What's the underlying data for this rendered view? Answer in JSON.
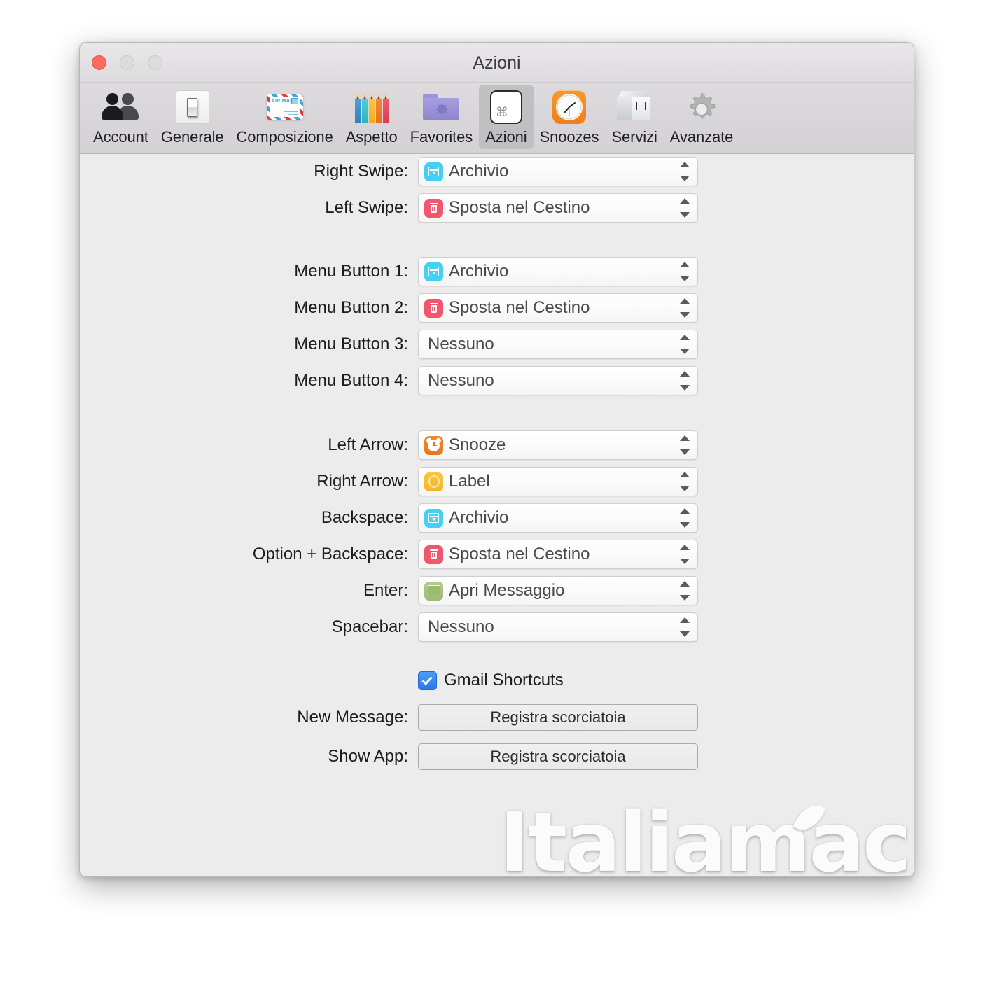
{
  "window": {
    "title": "Azioni",
    "traffic_lights": [
      "close",
      "minimize",
      "zoom"
    ]
  },
  "toolbar": {
    "items": [
      {
        "label": "Account",
        "icon": "people-icon",
        "selected": false
      },
      {
        "label": "Generale",
        "icon": "switch-icon",
        "selected": false
      },
      {
        "label": "Composizione",
        "icon": "airmail-icon",
        "selected": false
      },
      {
        "label": "Aspetto",
        "icon": "pencils-icon",
        "selected": false
      },
      {
        "label": "Favorites",
        "icon": "gear-folder-icon",
        "selected": false
      },
      {
        "label": "Azioni",
        "icon": "command-key-icon",
        "selected": true
      },
      {
        "label": "Snoozes",
        "icon": "alarm-clock-icon",
        "selected": false
      },
      {
        "label": "Servizi",
        "icon": "package-box-icon",
        "selected": false
      },
      {
        "label": "Avanzate",
        "icon": "gear-icon",
        "selected": false
      }
    ]
  },
  "settings": {
    "group_swipes": [
      {
        "label": "Right Swipe:",
        "value": "Archivio",
        "icon": "archive-icon"
      },
      {
        "label": "Left Swipe:",
        "value": "Sposta nel Cestino",
        "icon": "trash-icon"
      }
    ],
    "group_menu_buttons": [
      {
        "label": "Menu Button 1:",
        "value": "Archivio",
        "icon": "archive-icon"
      },
      {
        "label": "Menu Button 2:",
        "value": "Sposta nel Cestino",
        "icon": "trash-icon"
      },
      {
        "label": "Menu Button 3:",
        "value": "Nessuno",
        "icon": "none"
      },
      {
        "label": "Menu Button 4:",
        "value": "Nessuno",
        "icon": "none"
      }
    ],
    "group_keys": [
      {
        "label": "Left Arrow:",
        "value": "Snooze",
        "icon": "snooze-icon"
      },
      {
        "label": "Right Arrow:",
        "value": "Label",
        "icon": "label-icon"
      },
      {
        "label": "Backspace:",
        "value": "Archivio",
        "icon": "archive-icon"
      },
      {
        "label": "Option + Backspace:",
        "value": "Sposta nel Cestino",
        "icon": "trash-icon"
      },
      {
        "label": "Enter:",
        "value": "Apri Messaggio",
        "icon": "open-msg-icon"
      },
      {
        "label": "Spacebar:",
        "value": "Nessuno",
        "icon": "none"
      }
    ],
    "gmail_shortcuts": {
      "label": "Gmail Shortcuts",
      "checked": true
    },
    "shortcut_recorders": [
      {
        "label": "New Message:",
        "button": "Registra scorciatoia"
      },
      {
        "label": "Show App:",
        "button": "Registra scorciatoia"
      }
    ]
  },
  "watermark": {
    "text": "Italiamac"
  },
  "colors": {
    "archive": "#44d0f2",
    "trash": "#f2566f",
    "snooze": "#ee7d1d",
    "label": "#f8bd31",
    "open_message": "#a4c07d",
    "checkbox_blue": "#3a8af0",
    "window_bg": "#ececec",
    "toolbar_bg": "#d7d4d7",
    "selected_tab_bg": "#c0bfc1"
  }
}
